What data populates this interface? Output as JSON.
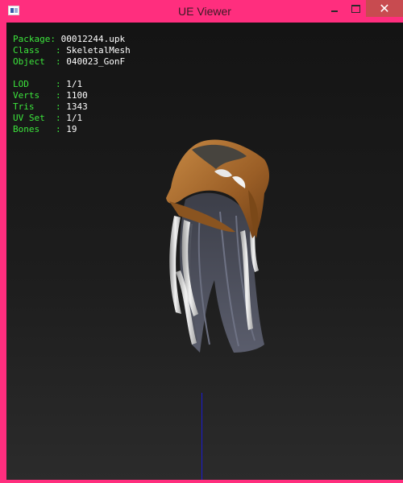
{
  "window": {
    "title": "UE Viewer",
    "controls": {
      "minimize": "",
      "maximize": "",
      "close": "✕"
    }
  },
  "info": {
    "package": {
      "label": "Package: ",
      "value": "00012244.upk"
    },
    "class": {
      "label": "Class   : ",
      "value": "SkeletalMesh"
    },
    "object": {
      "label": "Object  : ",
      "value": "040023_GonF"
    },
    "lod": {
      "label": "LOD     : ",
      "value": "1/1"
    },
    "verts": {
      "label": "Verts   : ",
      "value": "1100"
    },
    "tris": {
      "label": "Tris    : ",
      "value": "1343"
    },
    "uvset": {
      "label": "UV Set  : ",
      "value": "1/1"
    },
    "bones": {
      "label": "Bones   : ",
      "value": "19"
    }
  },
  "colors": {
    "frame": "#ff2e7e",
    "key_text": "#3ce63c",
    "value_text": "#ffffff",
    "axis": "#1a1ad0",
    "hat": "#a86a2c"
  }
}
